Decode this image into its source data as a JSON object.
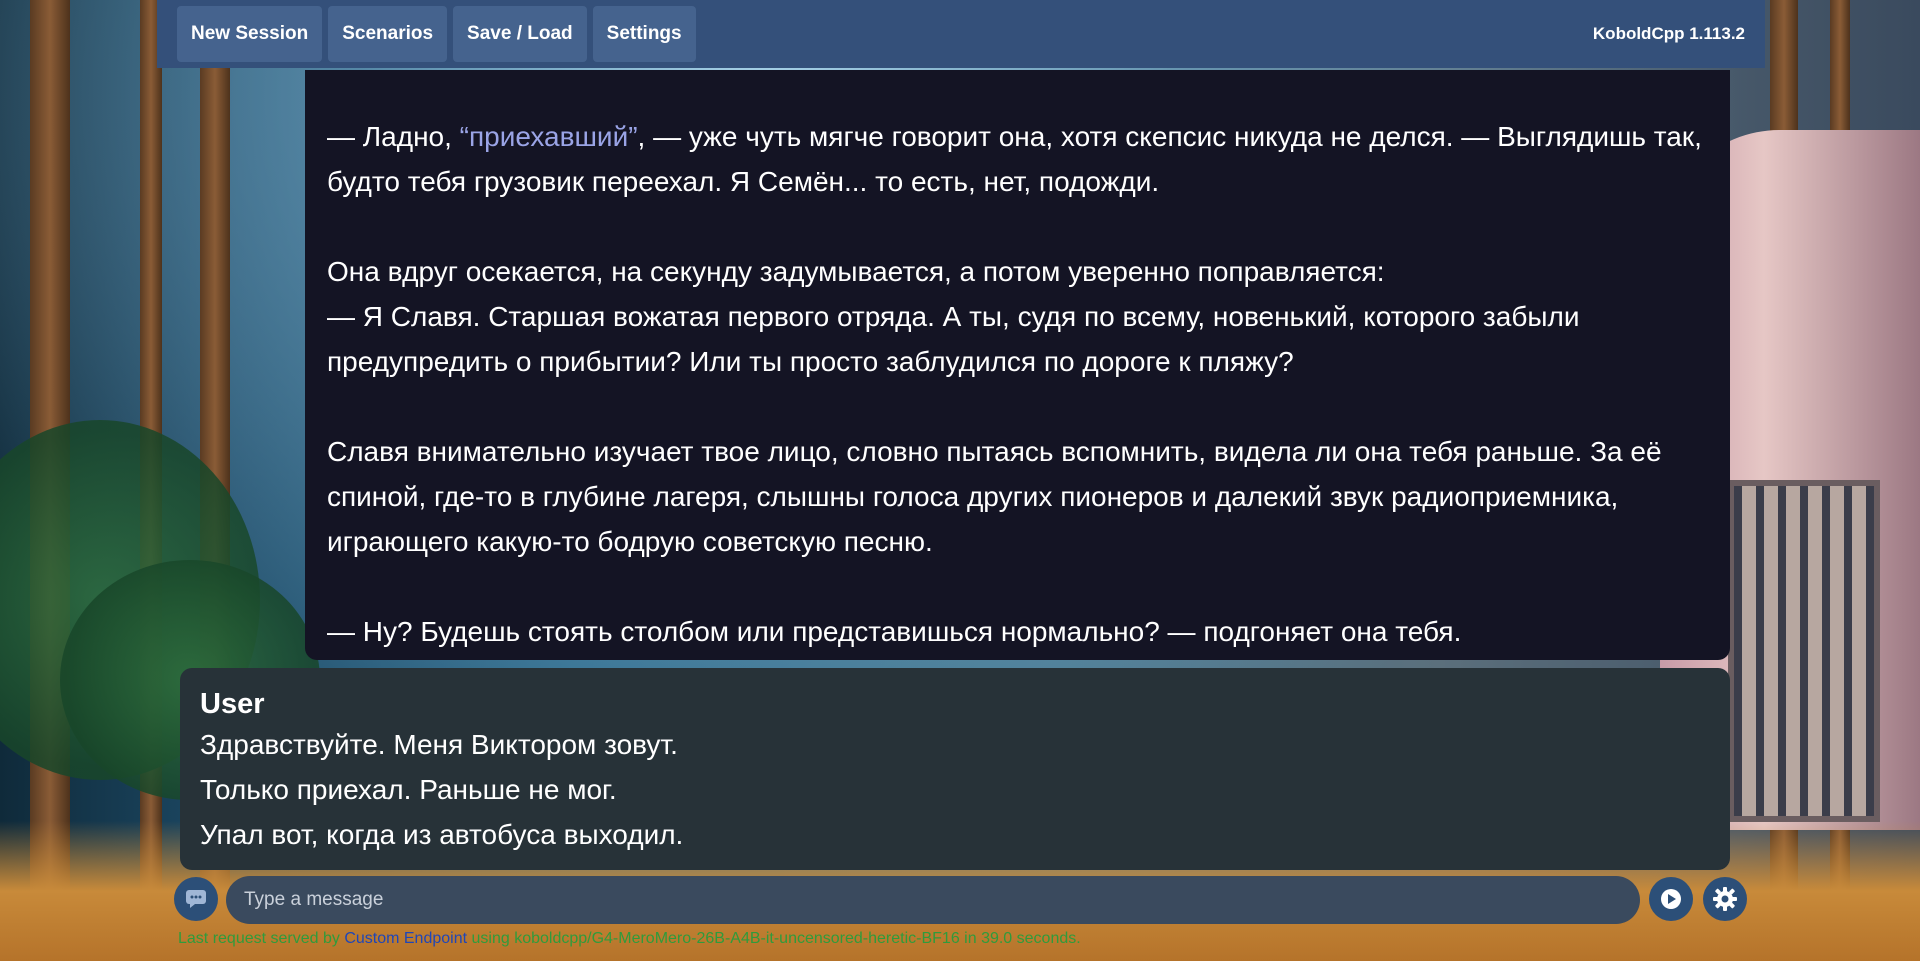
{
  "nav": {
    "buttons": [
      "New Session",
      "Scenarios",
      "Save / Load",
      "Settings"
    ],
    "version": "KoboldCpp 1.113.2"
  },
  "ai_message": {
    "p1_start": "— Ладно, ",
    "p1_quote": "“приехавший”",
    "p1_rest": ", — уже чуть мягче говорит она, хотя скепсис никуда не делся. — Выглядишь так, будто тебя грузовик переехал. Я Семён... то есть, нет, подожди.",
    "p2": "Она вдруг осекается, на секунду задумывается, а потом уверенно поправляется:\n— Я Славя. Старшая вожатая первого отряда. А ты, судя по всему, новенький, которого забыли предупредить о прибытии? Или ты просто заблудился по дороге к пляжу?",
    "p3": "Славя внимательно изучает твое лицо, словно пытаясь вспомнить, видела ли она тебя раньше. За её спиной, где-то в глубине лагеря, слышны голоса других пионеров и далекий звук радиоприемника, играющего какую-то бодрую советскую песню.",
    "p4": "— Ну? Будешь стоять столбом или представишься нормально? — подгоняет она тебя."
  },
  "user_message": {
    "name": "User",
    "lines": [
      "Здравствуйте. Меня Виктором зовут.",
      "Только приехал. Раньше не мог.",
      "Упал вот, когда из автобуса выходил."
    ]
  },
  "input": {
    "placeholder": "Type a message"
  },
  "status": {
    "prefix": "Last request served by ",
    "endpoint": "Custom Endpoint",
    "middle": " using ",
    "model": "koboldcpp/G4-MeroMero-26B-A4B-it-uncensored-heretic-BF16",
    "suffix": " in 39.0 seconds."
  },
  "icons": {
    "chat": "chat-bubble-icon",
    "send": "play-send-icon",
    "settings": "gear-icon"
  },
  "colors": {
    "topbar": "#34507a",
    "ai_bg": "#141424",
    "user_bg": "#273238",
    "quote": "#9aa4e6"
  }
}
